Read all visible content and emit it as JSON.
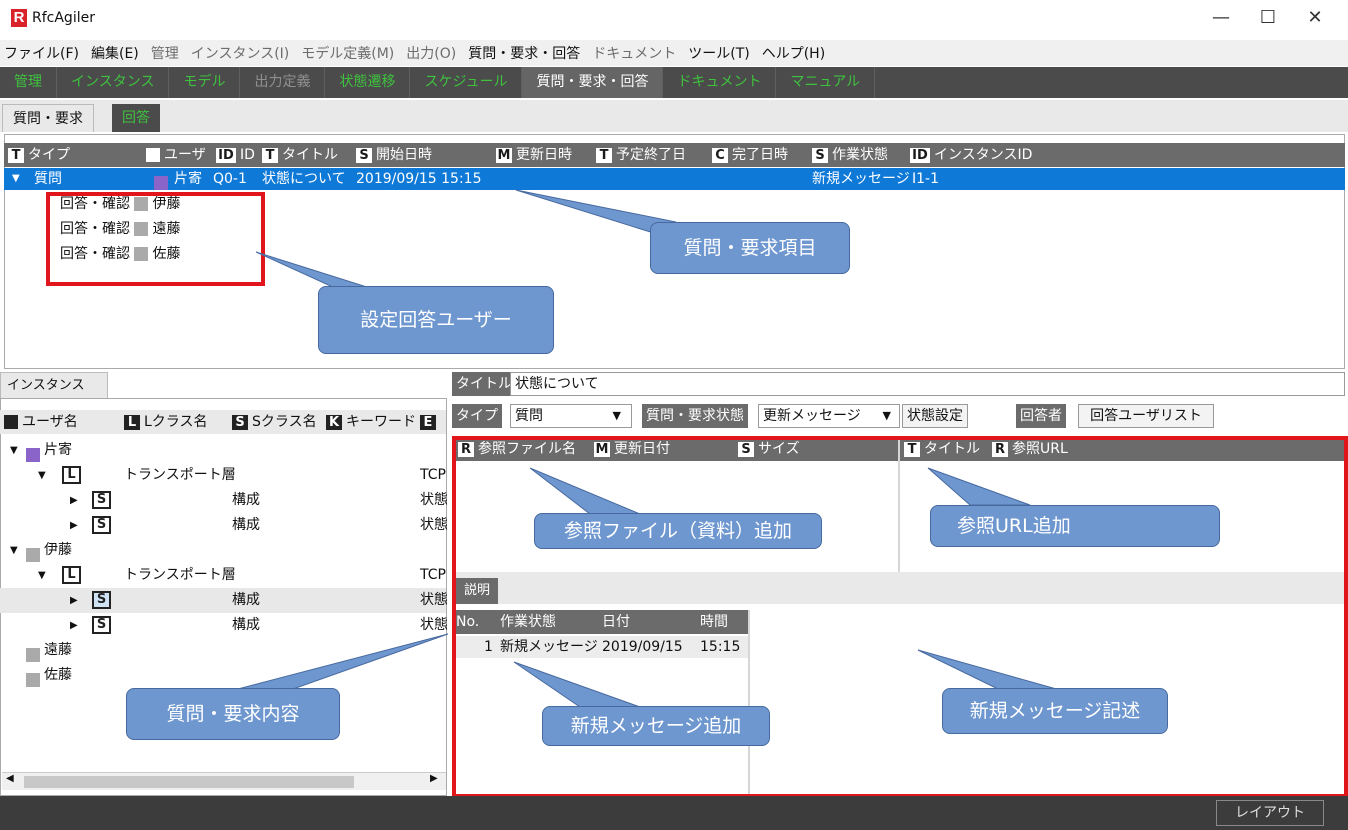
{
  "window": {
    "title": "RfcAgiler",
    "minimize": "—",
    "maximize": "☐",
    "close": "✕"
  },
  "menu": [
    "ファイル(F)",
    "編集(E)",
    "管理",
    "インスタンス(I)",
    "モデル定義(M)",
    "出力(O)",
    "質問・要求・回答",
    "ドキュメント",
    "ツール(T)",
    "ヘルプ(H)"
  ],
  "nav_tabs": [
    "管理",
    "インスタンス",
    "モデル",
    "出力定義",
    "状態遷移",
    "スケジュール",
    "質問・要求・回答",
    "ドキュメント",
    "マニュアル"
  ],
  "sub_tabs": [
    "質問・要求",
    "回答"
  ],
  "question_table": {
    "columns": [
      {
        "badge": "T",
        "label": "タイプ"
      },
      {
        "badge": "👤",
        "label": "ユーザ"
      },
      {
        "badge": "ID",
        "label": "ID"
      },
      {
        "badge": "T",
        "label": "タイトル"
      },
      {
        "badge": "S",
        "label": "開始日時"
      },
      {
        "badge": "M",
        "label": "更新日時"
      },
      {
        "badge": "T",
        "label": "予定終了日"
      },
      {
        "badge": "C",
        "label": "完了日時"
      },
      {
        "badge": "S",
        "label": "作業状態"
      },
      {
        "badge": "ID",
        "label": "インスタンスID"
      }
    ],
    "selected_row": {
      "type": "質問",
      "user": "片寄",
      "id": "Q0-1",
      "title": "状態について",
      "start": "2019/09/15 15:15",
      "status": "新規メッセージ",
      "instance_id": "I1-1"
    },
    "answer_rows": [
      {
        "type": "回答・確認",
        "user": "伊藤"
      },
      {
        "type": "回答・確認",
        "user": "遠藤"
      },
      {
        "type": "回答・確認",
        "user": "佐藤"
      }
    ]
  },
  "instance_panel": {
    "tab": "インスタンス",
    "columns": [
      {
        "badge": "👤",
        "label": "ユーザ名"
      },
      {
        "badge": "L",
        "label": "Lクラス名"
      },
      {
        "badge": "S",
        "label": "Sクラス名"
      },
      {
        "badge": "K",
        "label": "キーワード"
      },
      {
        "badge": "E",
        "label": ""
      }
    ],
    "tree": [
      {
        "kind": "user",
        "label": "片寄",
        "color": "#8a64c8",
        "level": 0,
        "arrow": "▼"
      },
      {
        "kind": "L",
        "label": "トランスポート層",
        "right": "TCP",
        "level": 1,
        "arrow": "▼"
      },
      {
        "kind": "S",
        "label": "構成",
        "right": "状態",
        "level": 2,
        "arrow": "▶"
      },
      {
        "kind": "S",
        "label": "構成",
        "right": "状態",
        "level": 2,
        "arrow": "▶"
      },
      {
        "kind": "user",
        "label": "伊藤",
        "color": "#aaaaaa",
        "level": 0,
        "arrow": "▼"
      },
      {
        "kind": "L",
        "label": "トランスポート層",
        "right": "TCP",
        "level": 1,
        "arrow": "▼"
      },
      {
        "kind": "S",
        "label": "構成",
        "right": "状態",
        "level": 2,
        "arrow": "▶",
        "highlight": true
      },
      {
        "kind": "S",
        "label": "構成",
        "right": "状態",
        "level": 2,
        "arrow": "▶"
      },
      {
        "kind": "user",
        "label": "遠藤",
        "color": "#aaaaaa",
        "level": 0,
        "arrow": ""
      },
      {
        "kind": "user",
        "label": "佐藤",
        "color": "#aaaaaa",
        "level": 0,
        "arrow": ""
      }
    ]
  },
  "form": {
    "title_label": "タイトル",
    "title_value": "状態について",
    "type_label": "タイプ",
    "type_value": "質問",
    "status_label": "質問・要求状態",
    "status_value": "更新メッセージ",
    "status_set": "状態設定",
    "answerer_label": "回答者",
    "answerer_button": "回答ユーザリスト"
  },
  "file_table": {
    "columns": [
      {
        "badge": "R",
        "label": "参照ファイル名"
      },
      {
        "badge": "M",
        "label": "更新日付"
      },
      {
        "badge": "S",
        "label": "サイズ"
      }
    ]
  },
  "url_table": {
    "columns": [
      {
        "badge": "T",
        "label": "タイトル"
      },
      {
        "badge": "R",
        "label": "参照URL"
      }
    ]
  },
  "description": {
    "tab": "説明",
    "columns": [
      "No.",
      "作業状態",
      "日付",
      "時間"
    ],
    "rows": [
      {
        "no": "1",
        "state": "新規メッセージ",
        "date": "2019/09/15",
        "time": "15:15"
      }
    ]
  },
  "callouts": {
    "question_item": "質問・要求項目",
    "answer_user": "設定回答ユーザー",
    "ref_file": "参照ファイル（資料）追加",
    "ref_url": "参照URL追加",
    "content": "質問・要求内容",
    "new_msg_add": "新規メッセージ追加",
    "new_msg_desc": "新規メッセージ記述"
  },
  "statusbar": {
    "layout_button": "レイアウト"
  },
  "colors": {
    "accent_green": "#3ec23e",
    "selection_blue": "#0f79d7",
    "annotation_red": "#e0161c",
    "callout_blue": "#6e97d0"
  }
}
